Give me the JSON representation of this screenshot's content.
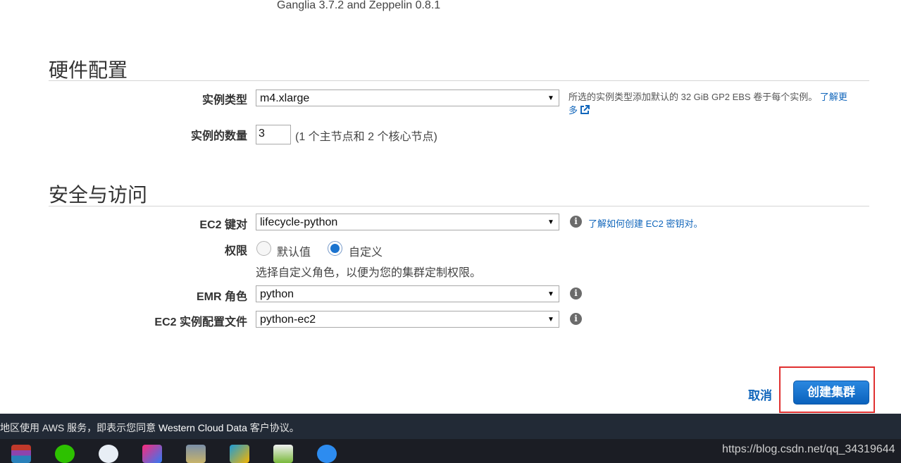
{
  "top_note": "Ganglia 3.7.2 and Zeppelin 0.8.1",
  "hardware": {
    "title": "硬件配置",
    "instance_type_label": "实例类型",
    "instance_type_value": "m4.xlarge",
    "instance_type_help": "所选的实例类型添加默认的 32 GiB GP2 EBS 卷于每个实例。",
    "learn_more": "了解更多",
    "instance_count_label": "实例的数量",
    "instance_count_value": "3",
    "instance_count_hint": "(1 个主节点和 2 个核心节点)"
  },
  "security": {
    "title": "安全与访问",
    "key_pair_label": "EC2 键对",
    "key_pair_value": "lifecycle-python",
    "key_pair_link": "了解如何创建 EC2 密钥对。",
    "permissions_label": "权限",
    "permission_default": "默认值",
    "permission_custom": "自定义",
    "permissions_hint": "选择自定义角色，以便为您的集群定制权限。",
    "emr_role_label": "EMR 角色",
    "emr_role_value": "python",
    "instance_profile_label": "EC2 实例配置文件",
    "instance_profile_value": "python-ec2"
  },
  "actions": {
    "cancel": "取消",
    "create": "创建集群"
  },
  "footer": {
    "prefix": "地区使用 AWS 服务，即表示您同意 ",
    "company": "Western Cloud Data",
    "suffix": " 客户协议。"
  },
  "taskbar": {
    "watermark": "https://blog.csdn.net/qq_34319644"
  },
  "colors": {
    "accent": "#1166bb",
    "primary_button": "#0b62bd",
    "highlight": "#e03030",
    "footer_bg": "#222a36"
  }
}
